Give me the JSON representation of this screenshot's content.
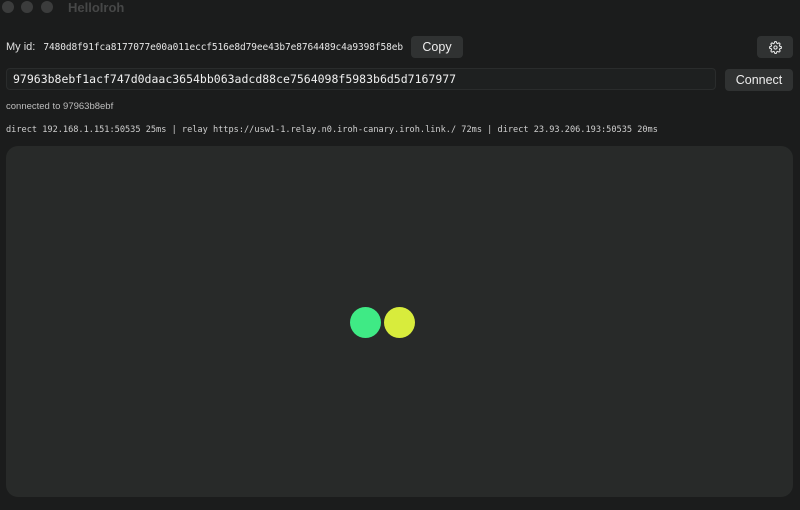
{
  "window": {
    "title": "HelloIroh"
  },
  "identity": {
    "label": "My id:",
    "value": "7480d8f91fca8177077e00a011eccf516e8d79ee43b7e8764489c4a9398f58eb",
    "copy_label": "Copy"
  },
  "settings": {
    "icon": "gear-icon"
  },
  "peer": {
    "value": "97963b8ebf1acf747d0daac3654bb063adcd88ce7564098f5983b6d5d7167977",
    "connect_label": "Connect"
  },
  "status": {
    "text": "connected to 97963b8ebf"
  },
  "paths": {
    "text": "direct 192.168.1.151:50535 25ms | relay https://usw1-1.relay.n0.iroh-canary.iroh.link./ 72ms | direct 23.93.206.193:50535 20ms"
  },
  "canvas": {
    "dots": [
      {
        "name": "local-peer-dot",
        "color": "#3fea85"
      },
      {
        "name": "remote-peer-dot",
        "color": "#d8ec3c"
      }
    ]
  },
  "colors": {
    "background": "#1b1c1c",
    "canvas": "#282a29",
    "button": "#303232"
  }
}
